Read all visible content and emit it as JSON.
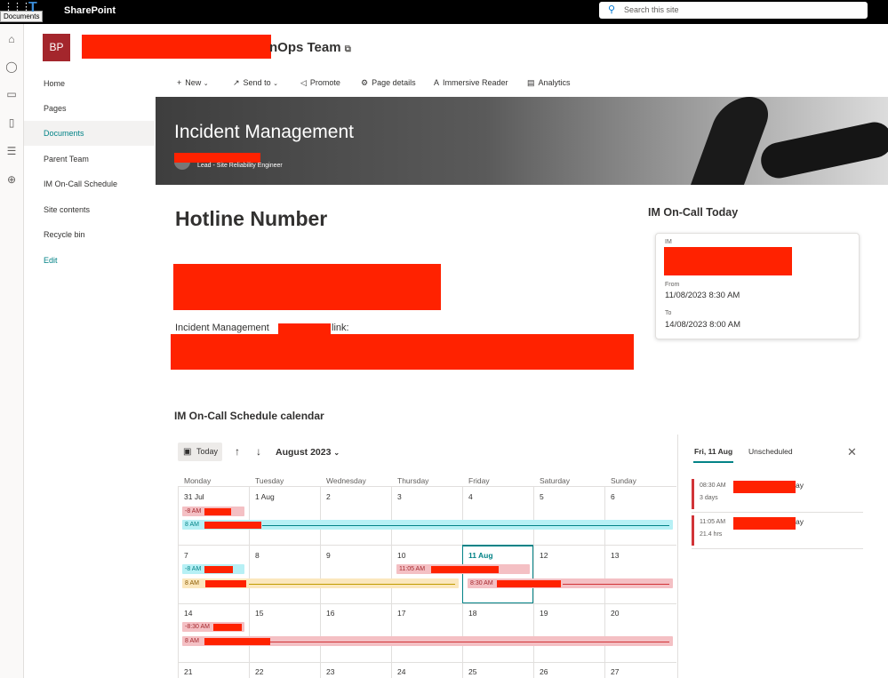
{
  "topbar": {
    "app_name": "SharePoint",
    "tooltip": "Documents",
    "search_placeholder": "Search this site"
  },
  "site": {
    "logo_initials": "BP",
    "title_suffix": "nOps Team"
  },
  "nav": {
    "items": [
      {
        "label": "Home"
      },
      {
        "label": "Pages"
      },
      {
        "label": "Documents"
      },
      {
        "label": "Parent Team"
      },
      {
        "label": "IM On-Call Schedule"
      },
      {
        "label": "Site contents"
      },
      {
        "label": "Recycle bin"
      },
      {
        "label": "Edit"
      }
    ],
    "active_index": 2
  },
  "commands": [
    {
      "label": "New",
      "icon": "plus-icon"
    },
    {
      "label": "Send to",
      "icon": "share-icon"
    },
    {
      "label": "Promote",
      "icon": "megaphone-icon"
    },
    {
      "label": "Page details",
      "icon": "gear-icon"
    },
    {
      "label": "Immersive Reader",
      "icon": "reader-icon"
    },
    {
      "label": "Analytics",
      "icon": "analytics-icon"
    }
  ],
  "hero": {
    "title": "Incident Management",
    "author_role": "Lead - Site Reliability Engineer"
  },
  "content": {
    "hotline_heading": "Hotline Number",
    "im_link_prefix": "Incident Management",
    "im_link_suffix": "link:"
  },
  "oncall": {
    "heading": "IM On-Call Today",
    "im_label": "IM",
    "from_label": "From",
    "from_value": "11/08/2023 8:30 AM",
    "to_label": "To",
    "to_value": "14/08/2023 8:00 AM"
  },
  "calendar": {
    "heading": "IM On-Call Schedule calendar",
    "today_label": "Today",
    "month_label": "August 2023",
    "weekdays": [
      "Monday",
      "Tuesday",
      "Wednesday",
      "Thursday",
      "Friday",
      "Saturday",
      "Sunday"
    ],
    "weeks": [
      [
        "31 Jul",
        "1 Aug",
        "2",
        "3",
        "4",
        "5",
        "6"
      ],
      [
        "7",
        "8",
        "9",
        "10",
        "11 Aug",
        "12",
        "13"
      ],
      [
        "14",
        "15",
        "16",
        "17",
        "18",
        "19",
        "20"
      ],
      [
        "21",
        "22",
        "23",
        "24",
        "25",
        "26",
        "27"
      ]
    ],
    "events": {
      "w1_a": "-8 AM",
      "w1_b": "8 AM",
      "w2_a": "-8 AM",
      "w2_b": "11:05 AM",
      "w2_c": "8 AM",
      "w2_d": "8:30 AM",
      "w3_a": "-8:30 AM",
      "w3_b": "8 AM"
    }
  },
  "panel": {
    "tab_day": "Fri, 11 Aug",
    "tab_unscheduled": "Unscheduled",
    "items": [
      {
        "time": "08:30 AM",
        "duration": "3 days",
        "tail": "ay"
      },
      {
        "time": "11:05 AM",
        "duration": "21.4 hrs",
        "tail": "ay"
      }
    ]
  }
}
